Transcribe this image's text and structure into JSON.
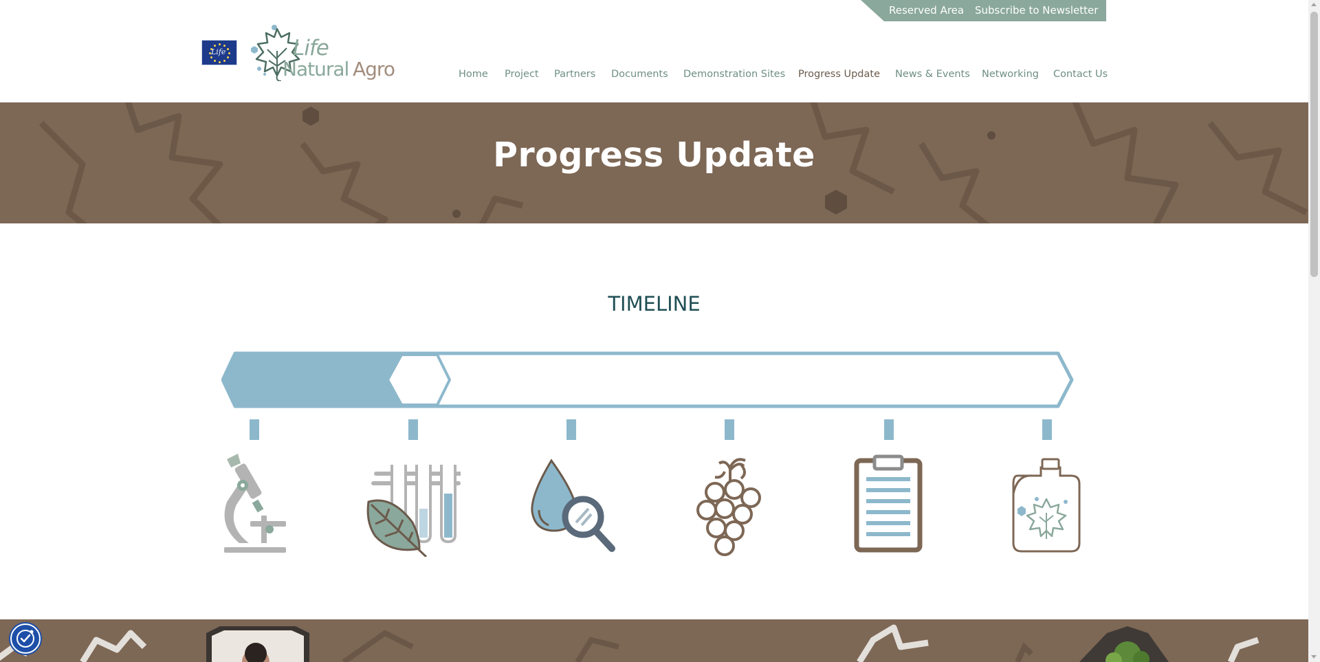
{
  "topbar": {
    "reserved_area": "Reserved Area",
    "subscribe": "Subscribe to Newsletter"
  },
  "logo": {
    "eu_flag_text": "Life",
    "life": "Life",
    "natural": "Natural",
    "agro": "Agro"
  },
  "nav": {
    "items": [
      {
        "label": "Home"
      },
      {
        "label": "Project"
      },
      {
        "label": "Partners"
      },
      {
        "label": "Documents"
      },
      {
        "label": "Demonstration Sites"
      },
      {
        "label": "Progress Update",
        "active": true
      },
      {
        "label": "News & Events"
      },
      {
        "label": "Networking"
      },
      {
        "label": "Contact Us"
      }
    ]
  },
  "hero": {
    "title": "Progress Update"
  },
  "timeline": {
    "heading": "TIMELINE",
    "progress": 0.25,
    "milestones": [
      {
        "icon": "microscope-icon"
      },
      {
        "icon": "leaf-test-tubes-icon"
      },
      {
        "icon": "water-drop-magnifier-icon"
      },
      {
        "icon": "grapes-icon"
      },
      {
        "icon": "clipboard-icon"
      },
      {
        "icon": "canister-leaf-icon"
      }
    ]
  },
  "colors": {
    "brand_green": "#8aa89b",
    "brand_brown": "#7d6755",
    "timeline_blue": "#8db8cc",
    "heading_teal": "#1f4f55",
    "nav_text": "#6e8f82",
    "nav_active": "#6b5a4c"
  },
  "accessibility": {
    "icon": "accessibility-icon"
  }
}
